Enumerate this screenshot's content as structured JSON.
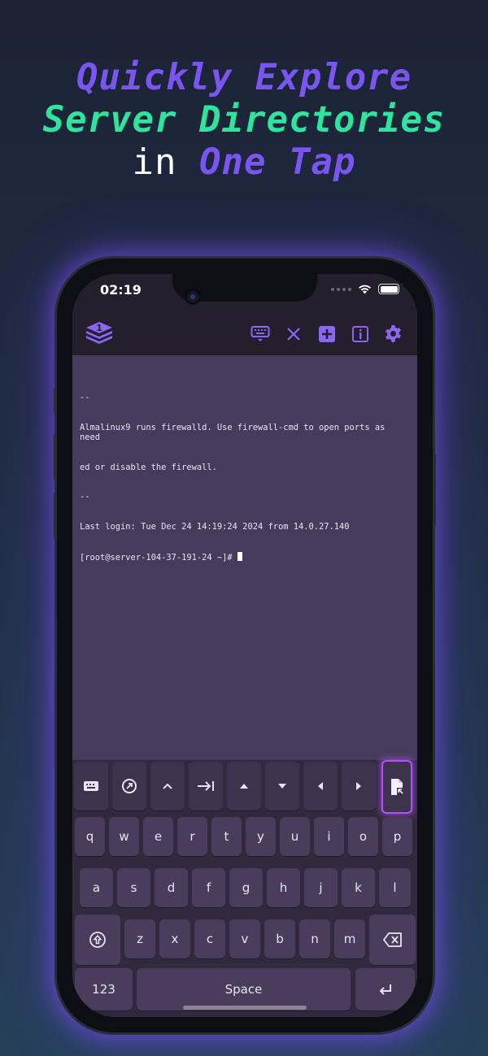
{
  "headline": {
    "line1": "Quickly Explore",
    "line2": "Server Directories",
    "line3_prefix": "in",
    "line3_accent": "One Tap"
  },
  "status_bar": {
    "time": "02:19"
  },
  "toolbar": {
    "app_logo_badge": "1",
    "icons": [
      "keyboard-icon",
      "close-icon",
      "add-icon",
      "info-icon",
      "gear-icon"
    ]
  },
  "terminal": {
    "lines": [
      "--",
      "Almalinux9 runs firewalld. Use firewall-cmd to open ports as need",
      "ed or disable the firewall.",
      "--",
      "Last login: Tue Dec 24 14:19:24 2024 from 14.0.27.140",
      "[root@server-104-37-191-24 ~]# "
    ]
  },
  "keyboard": {
    "accessory_keys": [
      "keyboard-icon",
      "compass-icon",
      "caret-up-icon",
      "tab-icon",
      "arrow-up-icon",
      "arrow-down-icon",
      "arrow-left-icon",
      "arrow-right-icon",
      "file-browser-icon"
    ],
    "row1": [
      "q",
      "w",
      "e",
      "r",
      "t",
      "y",
      "u",
      "i",
      "o",
      "p"
    ],
    "row2": [
      "a",
      "s",
      "d",
      "f",
      "g",
      "h",
      "j",
      "k",
      "l"
    ],
    "row3": [
      "z",
      "x",
      "c",
      "v",
      "b",
      "n",
      "m"
    ],
    "numbers_label": "123",
    "space_label": "Space"
  },
  "colors": {
    "accent_purple": "#7a55f0",
    "accent_green": "#2ee59d",
    "highlight_key": "#b84dff",
    "terminal_bg": "#463b5c"
  }
}
